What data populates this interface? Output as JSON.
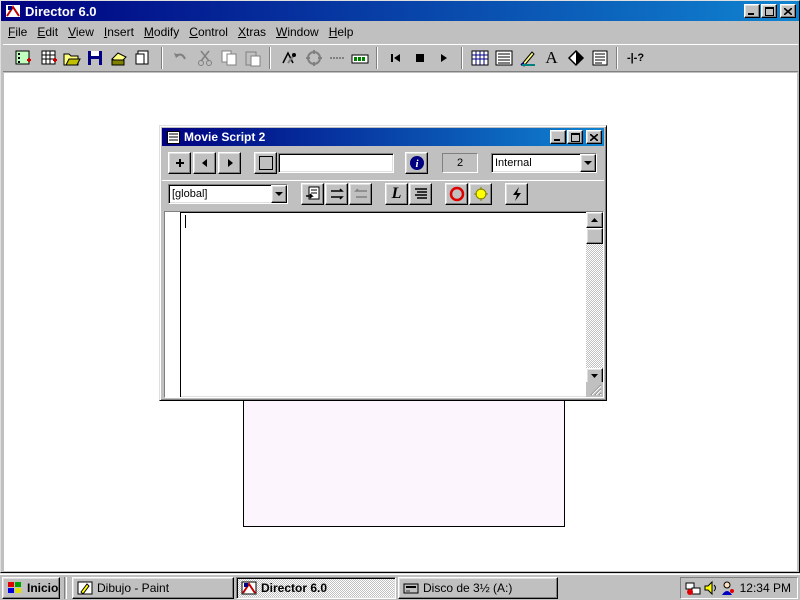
{
  "app": {
    "title": "Director 6.0",
    "menu": [
      "File",
      "Edit",
      "View",
      "Insert",
      "Modify",
      "Control",
      "Xtras",
      "Window",
      "Help"
    ],
    "menu_accel": [
      "F",
      "E",
      "V",
      "I",
      "M",
      "C",
      "X",
      "W",
      "H"
    ],
    "toolbar_icons": [
      "new-movie-icon",
      "new-cast-icon",
      "open-icon",
      "save-icon",
      "save-and-compact-icon",
      "import-icon",
      "undo-icon",
      "cut-icon",
      "copy-icon",
      "paste-icon",
      "exchange-cast-members-icon",
      "cast-member-properties-icon",
      "script-icon",
      "cast-icon",
      "rewind-icon",
      "stop-icon",
      "play-icon",
      "score-icon",
      "cast-window-icon",
      "paint-window-icon",
      "text-window-icon",
      "field-window-icon",
      "message-window-icon",
      "xtras-help-icon"
    ]
  },
  "script_window": {
    "title": "Movie Script 2",
    "cast_number": "2",
    "cast_name_value": "",
    "castlib_select": "Internal",
    "handler_select": "[global]",
    "code": ""
  },
  "taskbar": {
    "start_label": "Inicio",
    "tasks": [
      "Dibujo - Paint",
      "Director 6.0",
      "Disco de 3½ (A:)"
    ],
    "active_task": "Director 6.0",
    "clock": "12:34 PM"
  },
  "colors": {
    "titlebar_start": "#000080",
    "titlebar_end": "#1084d0",
    "stage_bg": "#fdf5fd",
    "desktop_chrome": "#c0c0c0"
  }
}
